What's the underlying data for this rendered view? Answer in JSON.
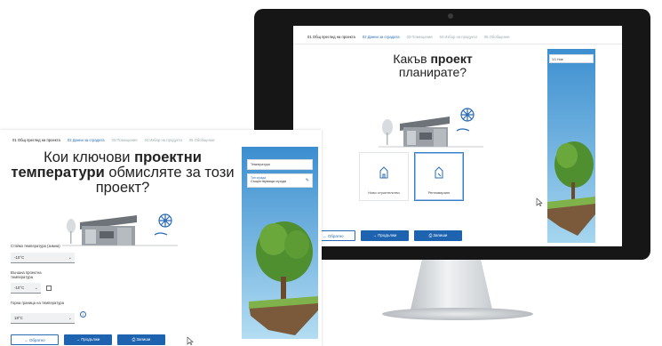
{
  "monitor": {
    "steps": [
      {
        "label": "01 Общ преглед на проекта",
        "state": "active"
      },
      {
        "label": "02 Данни за сградата",
        "state": "next"
      },
      {
        "label": "03 Помещения",
        "state": "todo"
      },
      {
        "label": "04 Избор на продукти",
        "state": "todo"
      },
      {
        "label": "05 Обобщение",
        "state": "todo"
      }
    ],
    "title_prefix": "Какъв ",
    "title_bold": "проект",
    "title_suffix": "планирате?",
    "options": [
      {
        "label": "Ново строителство",
        "selected": false
      },
      {
        "label": "Ренновиране",
        "selected": true
      }
    ],
    "buttons": {
      "back": "← Обратно",
      "next": "→ Продължи",
      "save": "⎙ Запиши"
    },
    "side_card": "1/1 Нов"
  },
  "laptop": {
    "steps": [
      {
        "label": "01 Общ преглед на проекта",
        "state": "active"
      },
      {
        "label": "02 Данни за сградата",
        "state": "next"
      },
      {
        "label": "03 Помещения",
        "state": "todo"
      },
      {
        "label": "04 Избор на продукти",
        "state": "todo"
      },
      {
        "label": "05 Обобщение",
        "state": "todo"
      }
    ],
    "title_line1": "Кои ключови ",
    "title_bold1": "проектни",
    "title_bold2": "температури",
    "title_line2_rest": " обмисляте за този",
    "title_line3": "проект?",
    "fields": [
      {
        "label": "Стойка температура (зимна)",
        "value": "-10°C"
      },
      {
        "label": "Външна проектна температура",
        "value": "-10°C"
      },
      {
        "label": "Горна граница на температура",
        "value": "18°C"
      }
    ],
    "buttons": {
      "back": "← Обратно",
      "next": "→ Продължи",
      "save": "⎙ Запиши"
    },
    "side_header": "Температури",
    "side_card_title": "Тип сграда",
    "side_card_value": "Съществуваща сграда"
  },
  "colors": {
    "accent": "#1e63b0",
    "sky": "#5fb3e0",
    "tree": "#4f8f2f"
  }
}
